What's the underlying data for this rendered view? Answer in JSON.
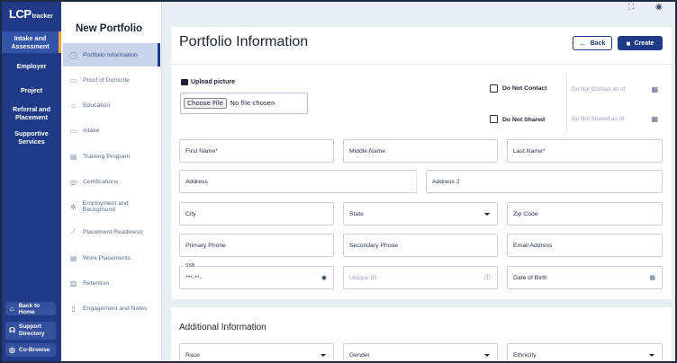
{
  "brand": {
    "logo_mark": "LCP",
    "logo_sub": "tracker"
  },
  "nav": {
    "items": [
      {
        "label": "Intake and Assessment",
        "active": true
      },
      {
        "label": "Employer"
      },
      {
        "label": "Project"
      },
      {
        "label": "Referral and Placement"
      },
      {
        "label": "Supportive Services"
      }
    ],
    "bottom": [
      {
        "label": "Back to Home",
        "icon": "home-icon"
      },
      {
        "label": "Support Directory",
        "icon": "headset-icon"
      },
      {
        "label": "Co-Browse",
        "icon": "cobrowse-icon"
      }
    ]
  },
  "sidebar": {
    "title": "New Portfolio",
    "items": [
      {
        "label": "Portfolio Information",
        "icon": "user-circle-icon",
        "active": true
      },
      {
        "label": "Proof of Domicile",
        "icon": "folder-icon"
      },
      {
        "label": "Education",
        "icon": "graduation-cap-icon"
      },
      {
        "label": "Intake",
        "icon": "folder-icon"
      },
      {
        "label": "Training Program",
        "icon": "clipboard-icon"
      },
      {
        "label": "Certifications",
        "icon": "badge-check-icon"
      },
      {
        "label": "Employment and Background",
        "icon": "gear-badge-icon"
      },
      {
        "label": "Placement Readiness",
        "icon": "handshake-icon"
      },
      {
        "label": "Work Placements",
        "icon": "clipboard-check-icon"
      },
      {
        "label": "Retention",
        "icon": "trash-icon"
      },
      {
        "label": "Engagement and Notes",
        "icon": "document-icon"
      }
    ]
  },
  "header": {
    "title": "Portfolio Information",
    "back_label": "Back",
    "create_label": "Create"
  },
  "upload": {
    "label": "Upload picture",
    "button": "Choose File",
    "status": "No file chosen"
  },
  "flags": {
    "do_not_contact": {
      "label": "Do Not Contact",
      "date_placeholder": "Do Not Contact as of"
    },
    "do_not_shared": {
      "label": "Do Not Shared",
      "date_placeholder": "Do Not Shared as of"
    }
  },
  "fields": {
    "first_name": "First Name*",
    "middle_name": "Middle Name",
    "last_name": "Last Name*",
    "address": "Address",
    "address2": "Address 2",
    "city": "City",
    "state": "State",
    "zip": "Zip Code",
    "primary_phone": "Primary Phone",
    "secondary_phone": "Secondary Phone",
    "email": "Email Address",
    "ssn_label": "SSN",
    "ssn_value": "***-**-",
    "unique_id": "Unique ID",
    "dob": "Date of Birth"
  },
  "additional": {
    "title": "Additional Information",
    "race": "Race",
    "gender": "Gender",
    "ethnicity": "Ethnicity"
  }
}
